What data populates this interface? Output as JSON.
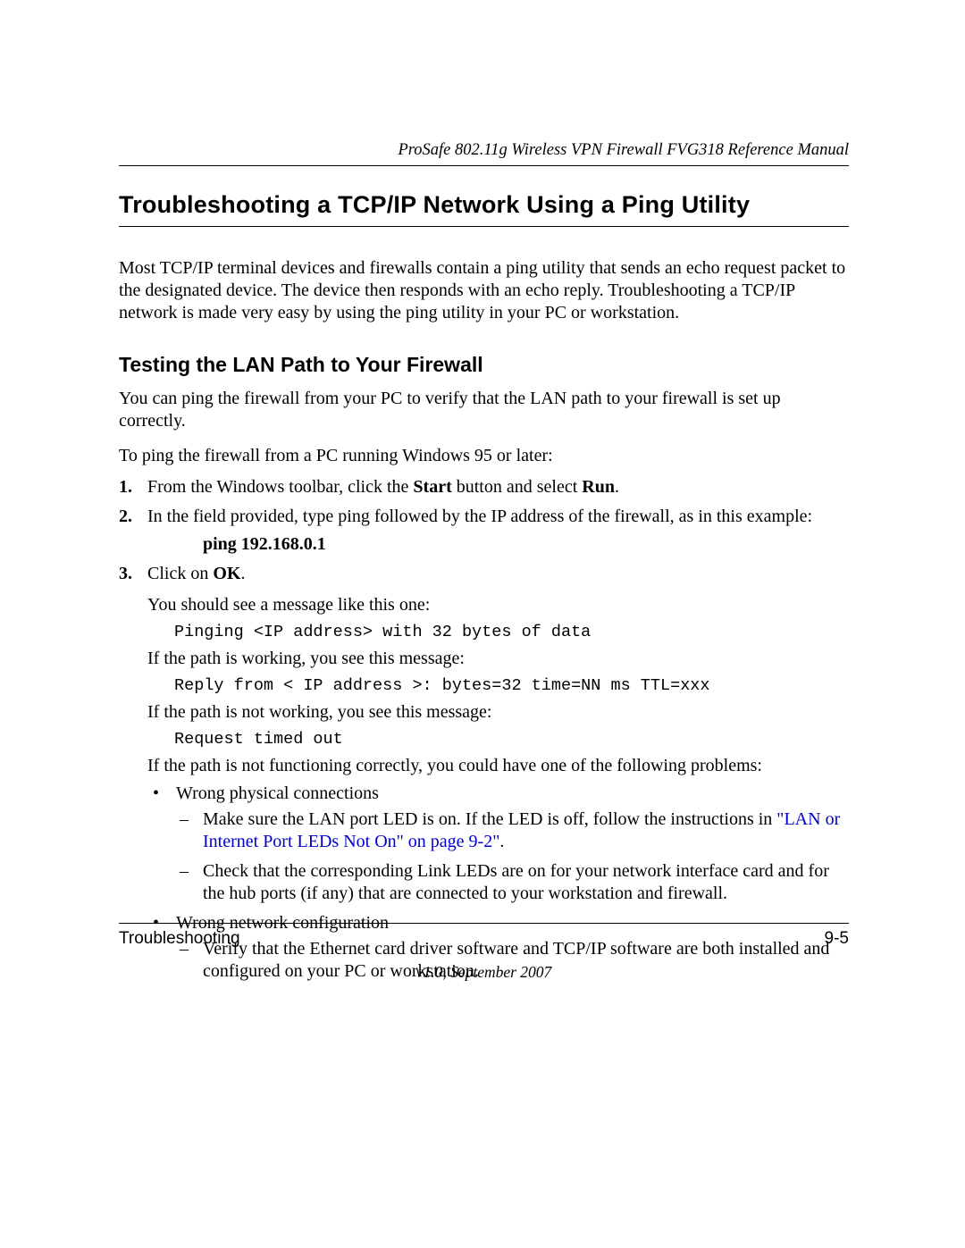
{
  "header": {
    "running": "ProSafe 802.11g Wireless VPN Firewall FVG318 Reference Manual"
  },
  "section": {
    "title": "Troubleshooting a TCP/IP Network Using a Ping Utility",
    "intro": "Most TCP/IP terminal devices and firewalls contain a ping utility that sends an echo request packet to the designated device. The device then responds with an echo reply. Troubleshooting a TCP/IP network is made very easy by using the ping utility in your PC or workstation."
  },
  "subsection": {
    "title": "Testing the LAN Path to Your Firewall",
    "p1": "You can ping the firewall from your PC to verify that the LAN path to your firewall is set up correctly.",
    "p2": "To ping the firewall from a PC running Windows 95 or later:"
  },
  "steps": {
    "s1": {
      "num": "1.",
      "pre": "From the Windows toolbar, click the ",
      "b1": "Start",
      "mid": " button and select ",
      "b2": "Run",
      "post": "."
    },
    "s2": {
      "num": "2.",
      "text": "In the field provided, type ping followed by the IP address of the firewall, as in this example:",
      "cmd": "ping 192.168.0.1"
    },
    "s3": {
      "num": "3.",
      "pre": "Click on ",
      "b1": "OK",
      "post": "."
    }
  },
  "after3": {
    "p1": "You should see a message like this one:",
    "code1": "Pinging <IP address> with 32 bytes of data",
    "p2": "If the path is working, you see this message:",
    "code2": "Reply from < IP address >: bytes=32 time=NN ms TTL=xxx",
    "p3": "If the path is not working, you see this message:",
    "code3": "Request timed out",
    "p4": "If the path is not functioning correctly, you could have one of the following problems:"
  },
  "bullets": {
    "b1": {
      "title": "Wrong physical connections",
      "d1_pre": "Make sure the LAN port LED is on. If the LED is off, follow the instructions in ",
      "d1_link": "\"LAN or Internet Port LEDs Not On\" on page 9-2\"",
      "d1_post": ".",
      "d2": "Check that the corresponding Link LEDs are on for your network interface card and for the hub ports (if any) that are connected to your workstation and firewall."
    },
    "b2": {
      "title": "Wrong network configuration",
      "d1": "Verify that the Ethernet card driver software and TCP/IP software are both installed and configured on your PC or workstation."
    }
  },
  "footer": {
    "left": "Troubleshooting",
    "right": "9-5",
    "version": "v1.0, September 2007"
  }
}
